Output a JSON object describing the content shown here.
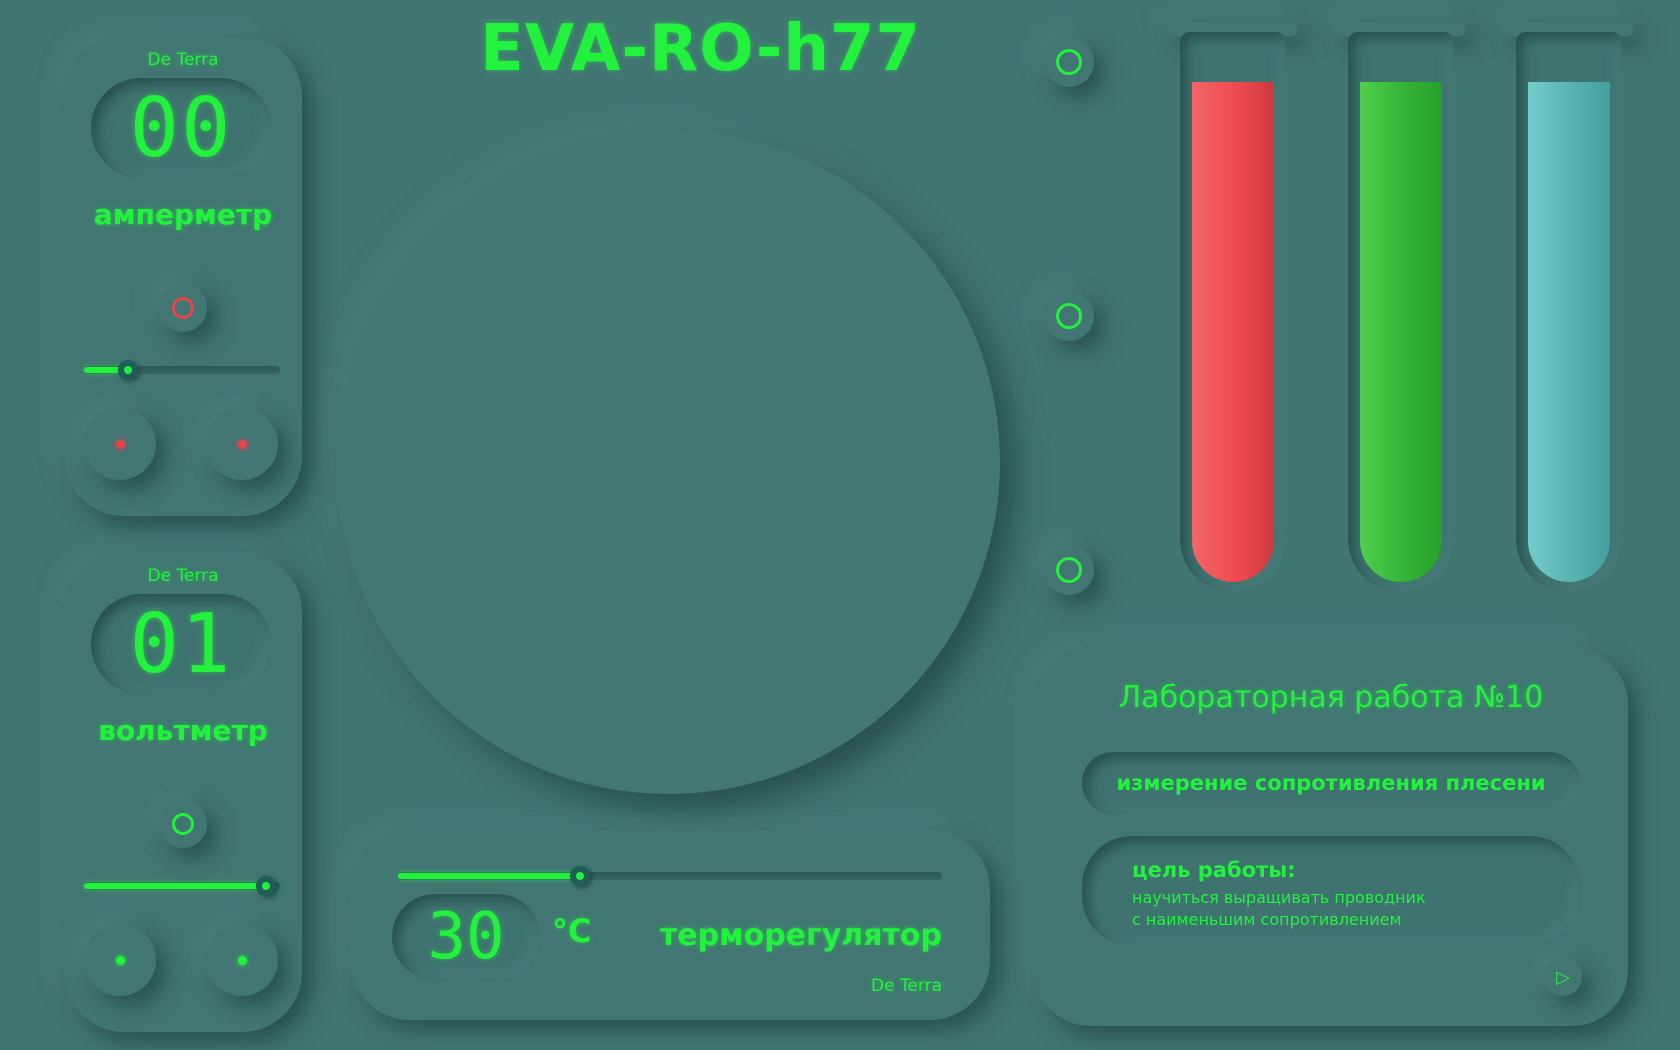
{
  "title": "EVA-RO-h77",
  "colors": {
    "background": "#417572",
    "accent": "#22f23d",
    "alert": "#e8444c"
  },
  "ammeter": {
    "brand": "De Terra",
    "display": "00",
    "label": "амперметр",
    "indicator_state": "red",
    "slider_value": 0.2,
    "terminal_color": "red"
  },
  "voltmeter": {
    "brand": "De Terra",
    "display": "01",
    "label": "вольтметр",
    "indicator_state": "green",
    "slider_value": 1.0,
    "terminal_color": "green"
  },
  "thermostat": {
    "display": "30",
    "unit": "°C",
    "label": "терморегулятор",
    "brand": "De Terra",
    "slider_value": 0.34
  },
  "side_buttons": [
    {
      "icon": "circle-icon"
    },
    {
      "icon": "circle-icon"
    },
    {
      "icon": "circle-icon"
    }
  ],
  "tubes": [
    {
      "color": "#ef4a4f",
      "level": 0.85
    },
    {
      "color": "#34b336",
      "level": 0.85
    },
    {
      "color": "#56b2b0",
      "level": 0.85
    }
  ],
  "lab": {
    "title": "Лабораторная работа №10",
    "subject": "измерение сопротивления плесени",
    "goal_heading": "цель работы:",
    "goal_line1": "научиться выращивать проводник",
    "goal_line2": "с наименьшим сопротивлением",
    "play_icon": "▷"
  }
}
